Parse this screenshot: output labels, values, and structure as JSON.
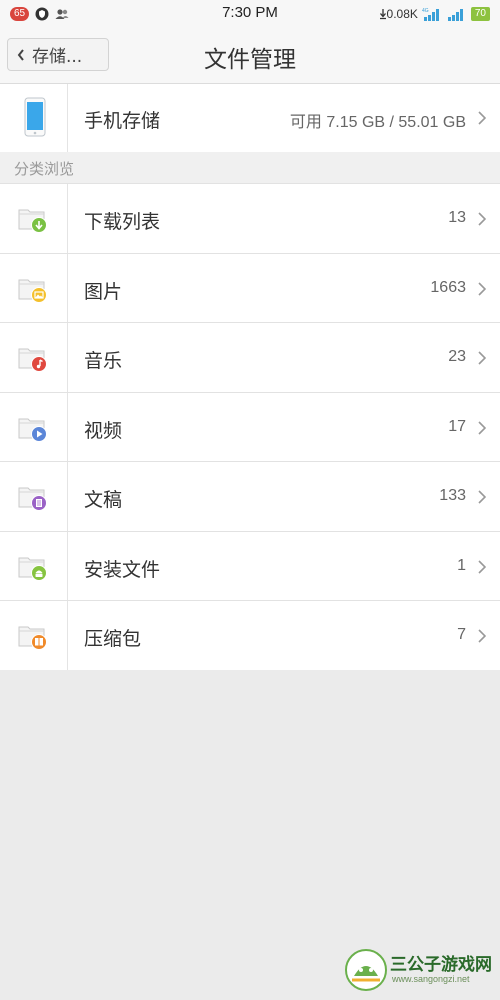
{
  "status_bar": {
    "notification_count": "65",
    "time": "7:30 PM",
    "net_speed": "0.08K",
    "battery": "70"
  },
  "nav": {
    "back_label": "存储...",
    "title": "文件管理"
  },
  "storage": {
    "label": "手机存储",
    "value": "可用 7.15 GB / 55.01 GB"
  },
  "section": {
    "title": "分类浏览"
  },
  "categories": [
    {
      "label": "下载列表",
      "count": "13",
      "icon": "download-folder-icon",
      "color": "#7ac143"
    },
    {
      "label": "图片",
      "count": "1663",
      "icon": "image-folder-icon",
      "color": "#f4c02c"
    },
    {
      "label": "音乐",
      "count": "23",
      "icon": "music-folder-icon",
      "color": "#e0493f"
    },
    {
      "label": "视频",
      "count": "17",
      "icon": "video-folder-icon",
      "color": "#5b86d8"
    },
    {
      "label": "文稿",
      "count": "133",
      "icon": "document-folder-icon",
      "color": "#9a62c6"
    },
    {
      "label": "安装文件",
      "count": "1",
      "icon": "android-folder-icon",
      "color": "#86c440"
    },
    {
      "label": "压缩包",
      "count": "7",
      "icon": "archive-folder-icon",
      "color": "#f08a2a"
    }
  ],
  "watermark": {
    "brand": "三公子游戏网",
    "url": "www.sangongzi.net"
  }
}
